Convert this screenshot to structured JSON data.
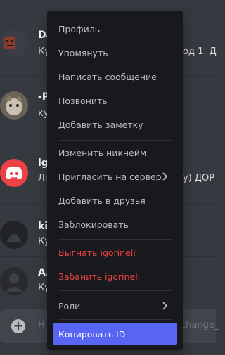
{
  "chat": {
    "messages": [
      {
        "author": "Da",
        "preview": "Ку",
        "trail": "од 1. Д"
      },
      {
        "author": "-P",
        "preview": "ку",
        "trail": ""
      },
      {
        "author": "ig",
        "preview": "Лі",
        "trail": "у) ДОР"
      },
      {
        "author": "kil",
        "preview": "Ку",
        "trail": ""
      },
      {
        "author": "A.",
        "preview": "Ку",
        "trail": ""
      }
    ],
    "composer": {
      "placeholder": "Н",
      "trail": "change_"
    }
  },
  "context_menu": {
    "items": [
      {
        "label": "Профиль"
      },
      {
        "label": "Упомянуть"
      },
      {
        "label": "Написать сообщение"
      },
      {
        "label": "Позвонить"
      },
      {
        "label": "Добавить заметку"
      },
      {
        "label": "Изменить никнейм"
      },
      {
        "label": "Пригласить на сервер"
      },
      {
        "label": "Добавить в друзья"
      },
      {
        "label": "Заблокировать"
      },
      {
        "label": "Выгнать igorineli"
      },
      {
        "label": "Забанить igorineli"
      },
      {
        "label": "Роли"
      },
      {
        "label": "Копировать ID"
      }
    ]
  },
  "colors": {
    "background": "#36393f",
    "menu_background": "#18191c",
    "danger": "#ed4245",
    "accent": "#5865f2"
  }
}
